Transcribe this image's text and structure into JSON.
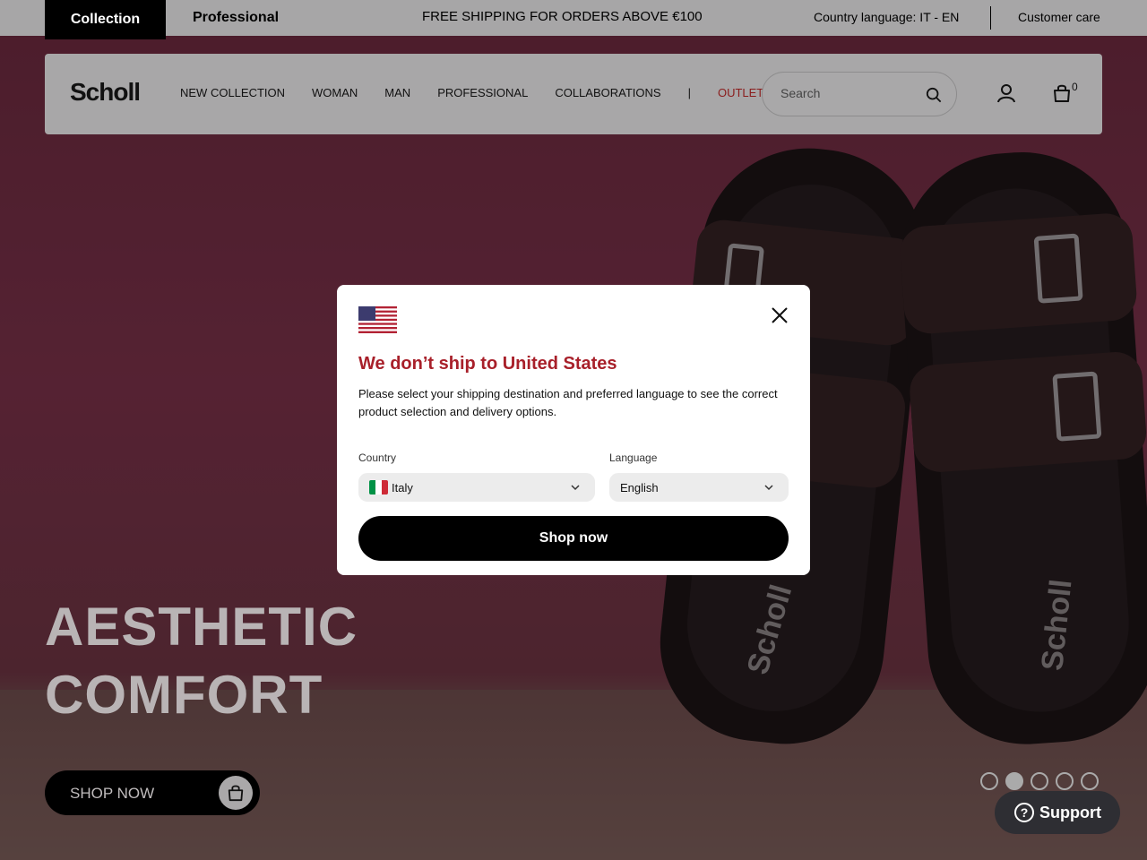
{
  "topbar": {
    "tab_collection": "Collection",
    "tab_professional": "Professional",
    "promo": "FREE SHIPPING FOR ORDERS ABOVE €100",
    "country_language": "Country language: IT - EN",
    "customer_care": "Customer care"
  },
  "nav": {
    "logo": "Scholl",
    "links": [
      "NEW COLLECTION",
      "WOMAN",
      "MAN",
      "PROFESSIONAL",
      "COLLABORATIONS"
    ],
    "separator": "|",
    "outlet": "OUTLET",
    "search_placeholder": "Search",
    "cart_count": "0",
    "icons": {
      "search": "search-icon",
      "account": "user-icon",
      "cart": "bag-icon"
    }
  },
  "hero": {
    "title_line1": "AESTHETIC",
    "title_line2": "COMFORT",
    "cta": "SHOP NOW",
    "product_brand": "Scholl",
    "slides_total": 5,
    "active_slide": 2
  },
  "support": {
    "label": "Support"
  },
  "modal": {
    "title": "We don’t ship to United States",
    "text": "Please select your shipping destination and preferred language to see the correct product selection and delivery options.",
    "country_label": "Country",
    "country_value": "Italy",
    "language_label": "Language",
    "language_value": "English",
    "button": "Shop now"
  },
  "colors": {
    "brand_red": "#a8202a",
    "outlet_red": "#8a1c1c",
    "black": "#000000",
    "support_bg": "#2e2e33"
  }
}
